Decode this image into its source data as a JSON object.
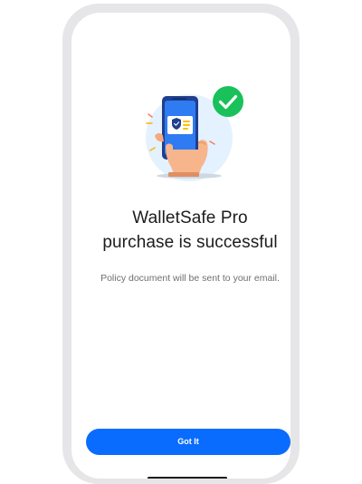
{
  "success_screen": {
    "headline_line1": "WalletSafe Pro",
    "headline_line2": "purchase is successful",
    "subtext": "Policy document will be sent to your email.",
    "cta_label": "Got It"
  },
  "illustration": {
    "name": "phone-in-hand-illustration",
    "check_icon": "checkmark-circle-icon",
    "shield_icon": "shield-icon"
  },
  "colors": {
    "accent": "#0a6cff",
    "success": "#18c15a",
    "frame": "#e6e6e8",
    "illustration_bg": "#e4f2ff"
  }
}
